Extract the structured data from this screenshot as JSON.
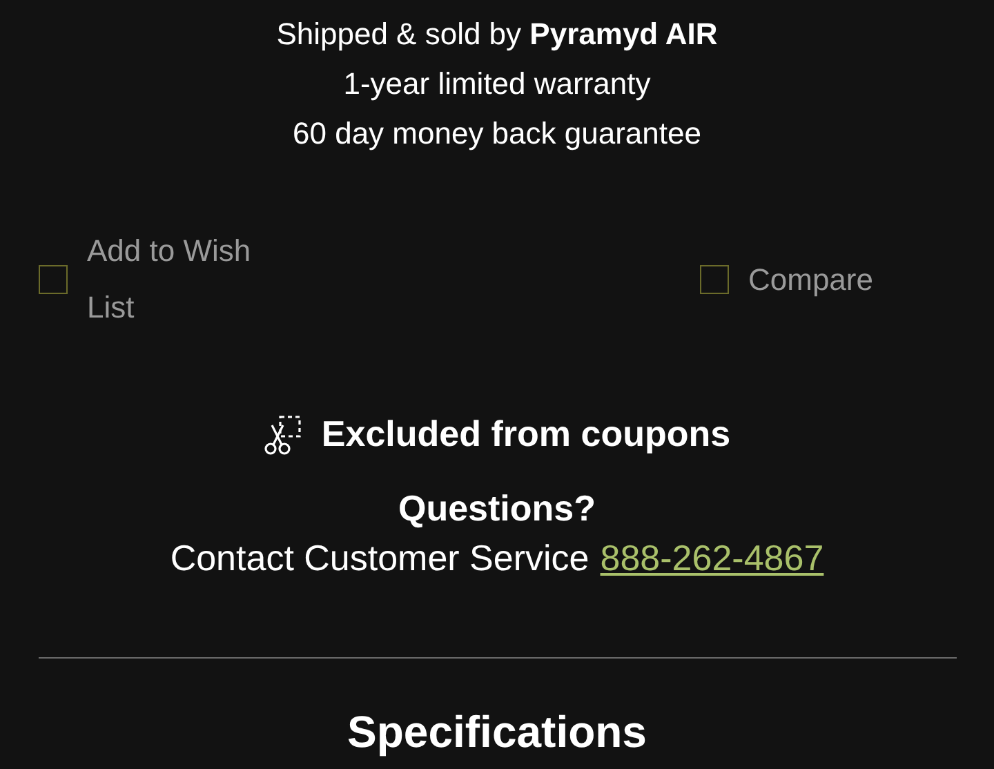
{
  "seller_info": [
    "Shipped & sold by **Pyramyd AIR**",
    "1-year limited warranty",
    "60 day money back guarantee"
  ],
  "options": [
    {
      "label": "Add to Wish List",
      "checked": false
    },
    {
      "label": "Compare",
      "checked": false
    }
  ],
  "coupon_notice": "Excluded from coupons",
  "questions": {
    "heading": "Questions?",
    "text": "Contact Customer Service",
    "phone": "888-262-4867"
  },
  "section_heading": "Specifications"
}
